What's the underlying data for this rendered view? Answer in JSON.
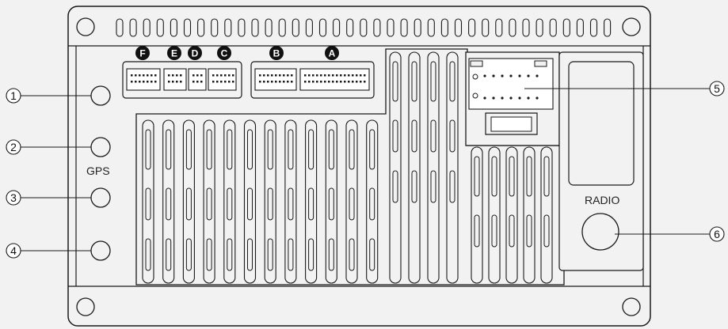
{
  "callouts": {
    "c1": "1",
    "c2": "2",
    "c3": "3",
    "c4": "4",
    "c5": "5",
    "c6": "6"
  },
  "labels": {
    "gps": "GPS",
    "radio": "RADIO"
  },
  "connectors": {
    "f": "F",
    "e": "E",
    "d": "D",
    "c": "C",
    "b": "B",
    "a": "A"
  },
  "colors": {
    "background": "#f2f2f2",
    "stroke": "#1a1a1a",
    "badge": "#111111"
  }
}
